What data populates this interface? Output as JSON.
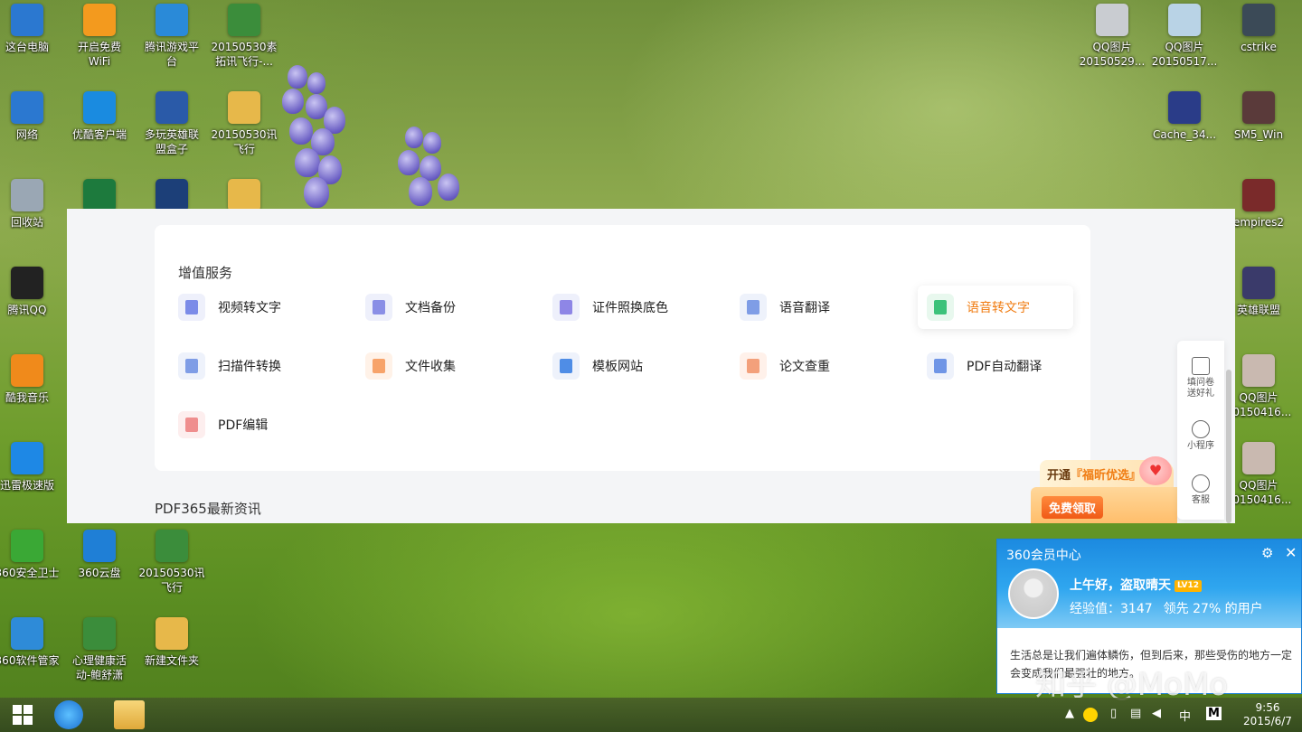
{
  "desktop": {
    "left_icons": [
      {
        "label": "这台电脑",
        "icon": "computer-icon",
        "color": "#2b78d0"
      },
      {
        "label": "开启免费\nWiFi",
        "icon": "wifi-icon",
        "color": "#f39a1e"
      },
      {
        "label": "腾讯游戏平\n台",
        "icon": "game-platform-icon",
        "color": "#2a8ad8"
      },
      {
        "label": "20150530素\n拓讯飞行-...",
        "icon": "archive-icon",
        "color": "#3b8d3b"
      },
      {
        "label": "网络",
        "icon": "network-icon",
        "color": "#2b78d0"
      },
      {
        "label": "优酷客户端",
        "icon": "youku-icon",
        "color": "#1a8be0"
      },
      {
        "label": "多玩英雄联\n盟盒子",
        "icon": "lol-box-icon",
        "color": "#2a5aa8"
      },
      {
        "label": "20150530讯\n飞行",
        "icon": "folder-icon",
        "color": "#e7b84a"
      },
      {
        "label": "回收站",
        "icon": "recycle-bin-icon",
        "color": "#9aa7b4"
      },
      {
        "label": "",
        "icon": "excel-icon",
        "color": "#1d7a3d"
      },
      {
        "label": "",
        "icon": "photoshop-icon",
        "color": "#1c3f78"
      },
      {
        "label": "",
        "icon": "folder-icon",
        "color": "#e7b84a"
      },
      {
        "label": "腾讯QQ",
        "icon": "qq-icon",
        "color": "#222222"
      },
      {
        "label": "酷我音乐",
        "icon": "kuwo-icon",
        "color": "#f08a1b"
      },
      {
        "label": "迅雷极速版",
        "icon": "thunder-icon",
        "color": "#1e88e5"
      },
      {
        "label": "360安全卫士",
        "icon": "360-security-icon",
        "color": "#3aa835"
      },
      {
        "label": "360云盘",
        "icon": "360-cloud-icon",
        "color": "#1f7fd6"
      },
      {
        "label": "20150530讯\n飞行",
        "icon": "archive-icon",
        "color": "#3b8d3b"
      },
      {
        "label": "360软件管家",
        "icon": "360-software-icon",
        "color": "#2e8bd8"
      },
      {
        "label": "心理健康活\n动-鲍舒潇",
        "icon": "archive-icon",
        "color": "#3b8d3b"
      },
      {
        "label": "新建文件夹",
        "icon": "folder-icon",
        "color": "#e7b84a"
      }
    ],
    "right_icons": [
      {
        "label": "QQ图片\n20150529...",
        "icon": "image-icon",
        "color": "#c9ccd1"
      },
      {
        "label": "QQ图片\n20150517...",
        "icon": "image-icon",
        "color": "#b9d3e6"
      },
      {
        "label": "cstrike",
        "icon": "cstrike-icon",
        "color": "#3b4a57"
      },
      {
        "label": "Cache_34...",
        "icon": "phone-icon",
        "color": "#2a3c88"
      },
      {
        "label": "SM5_Win",
        "icon": "sm5-icon",
        "color": "#5a3a3a"
      },
      {
        "label": "empires2",
        "icon": "empires-icon",
        "color": "#7a2a2a"
      },
      {
        "label": "英雄联盟",
        "icon": "lol-icon",
        "color": "#3a3a6a"
      },
      {
        "label": "QQ图片\n20150416...",
        "icon": "image-icon",
        "color": "#c9b9b0"
      },
      {
        "label": "QQ图片\n20150416...",
        "icon": "image-icon",
        "color": "#c9b9b0"
      }
    ]
  },
  "app": {
    "section_title": "增值服务",
    "services": [
      {
        "label": "视频转文字",
        "icon": "video-to-text-icon",
        "bg": "#eef0fb",
        "fg": "#7b8be8",
        "active": false
      },
      {
        "label": "文档备份",
        "icon": "document-backup-icon",
        "bg": "#eef0fb",
        "fg": "#8a8fe6",
        "active": false
      },
      {
        "label": "证件照换底色",
        "icon": "id-photo-icon",
        "bg": "#eef0fb",
        "fg": "#8e86e6",
        "active": false
      },
      {
        "label": "语音翻译",
        "icon": "voice-translate-icon",
        "bg": "#eef2fb",
        "fg": "#7f9de6",
        "active": false
      },
      {
        "label": "语音转文字",
        "icon": "speech-to-text-icon",
        "bg": "#e8f8ee",
        "fg": "#3cc27a",
        "active": true
      },
      {
        "label": "扫描件转换",
        "icon": "scan-convert-icon",
        "bg": "#eef2fb",
        "fg": "#7f9de6",
        "active": false
      },
      {
        "label": "文件收集",
        "icon": "file-collect-icon",
        "bg": "#fff2e8",
        "fg": "#f7a36a",
        "active": false
      },
      {
        "label": "模板网站",
        "icon": "template-site-icon",
        "bg": "#eef2fb",
        "fg": "#4f8de6",
        "active": false
      },
      {
        "label": "论文查重",
        "icon": "paper-check-icon",
        "bg": "#fff1ea",
        "fg": "#f3a07b",
        "active": false
      },
      {
        "label": "PDF自动翻译",
        "icon": "pdf-translate-icon",
        "bg": "#eef2fb",
        "fg": "#6f95e6",
        "active": false
      },
      {
        "label": "PDF编辑",
        "icon": "pdf-edit-icon",
        "bg": "#fdeeee",
        "fg": "#ef8e8e",
        "active": false
      }
    ],
    "news_title": "PDF365最新资讯",
    "sidebar": {
      "survey": "填问卷\n送好礼",
      "miniprogram": "小程序",
      "service": "客服"
    },
    "promo": {
      "line1_prefix": "开通",
      "line1_highlight": "『福昕优选』",
      "button": "免费领取"
    }
  },
  "vip_popup": {
    "title": "360会员中心",
    "greeting": "上午好，盗取晴天",
    "level": "LV12",
    "exp_label": "经验值：3147",
    "rank_label": "领先 27% 的用户",
    "message": "生活总是让我们遍体鳞伤，但到后来，那些受伤的地方一定会变成我们最强壮的地方。"
  },
  "watermark": "知乎 @MoMo",
  "taskbar": {
    "ime": "中",
    "ime2": "M",
    "time": "9:56",
    "date": "2015/6/7"
  }
}
